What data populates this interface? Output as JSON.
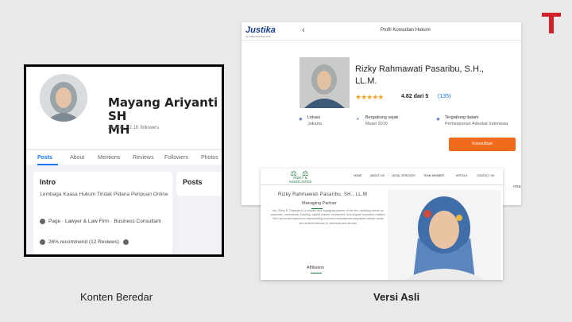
{
  "brand": {
    "tempo_color": "#d0202a"
  },
  "facebook": {
    "name_line1": "Mayang Ariyanti SH",
    "name_line2": "MH",
    "stats": "2K likes • 2.1K followers",
    "tabs": [
      "Posts",
      "About",
      "Mentions",
      "Reviews",
      "Followers",
      "Photos"
    ],
    "intro": {
      "title": "Intro",
      "description": "Lembaga Kuasa Hukum Tindak Pidana Peripuan Online",
      "category": "Page · Lawyer & Law Firm · Business Consultant",
      "recommend": "26% recommend (12 Reviews)"
    },
    "posts_title": "Posts",
    "accent": "#1877f2"
  },
  "justika": {
    "logo": "Justika",
    "logo_sub": "by hukumonline.com",
    "page_title": "Profil Konsultan Hukum",
    "name_line1": "Rizky Rahmawati Pasaribu, S.H.,",
    "name_line2": "LL.M.",
    "stars": "★★★★★",
    "rating": "4.82 dari 5",
    "review_count": "(135)",
    "info": [
      {
        "label": "Lokasi",
        "value": "Jakarta"
      },
      {
        "label": "Bergabung sejak",
        "value": "Maret 2019"
      },
      {
        "label": "Tergabung dalam",
        "value": "Perhimpunan Advokat Indonesia"
      }
    ],
    "button": "Konsultasi",
    "more": "rmasi",
    "button_color": "#f26a1b"
  },
  "original": {
    "logo_mark": "⚖ ⚖",
    "logo_text": "RIZKY & ASSOCIATES",
    "nav": [
      "HOME",
      "ABOUT US",
      "LEGAL SERVICES",
      "TEAM MEMBER",
      "ARTICLE",
      "CONTACT US"
    ],
    "name": "Rizky Rahmawati Pasaribu, SH., LL.M",
    "section1": "Managing Partner",
    "bio": "Ms. Rizky R. Pasaribu is a founder and managing partner of the firm, advising clients on corporate, commercial, banking, capital market, investment, and dispute resolution matters. She has broad experience representing local and multinational companies before courts and arbitral tribunals in Indonesia and abroad.",
    "section2": "Affiliation",
    "accent": "#1a7a3e"
  },
  "captions": {
    "left": "Konten Beredar",
    "right": "Versi Asli"
  }
}
